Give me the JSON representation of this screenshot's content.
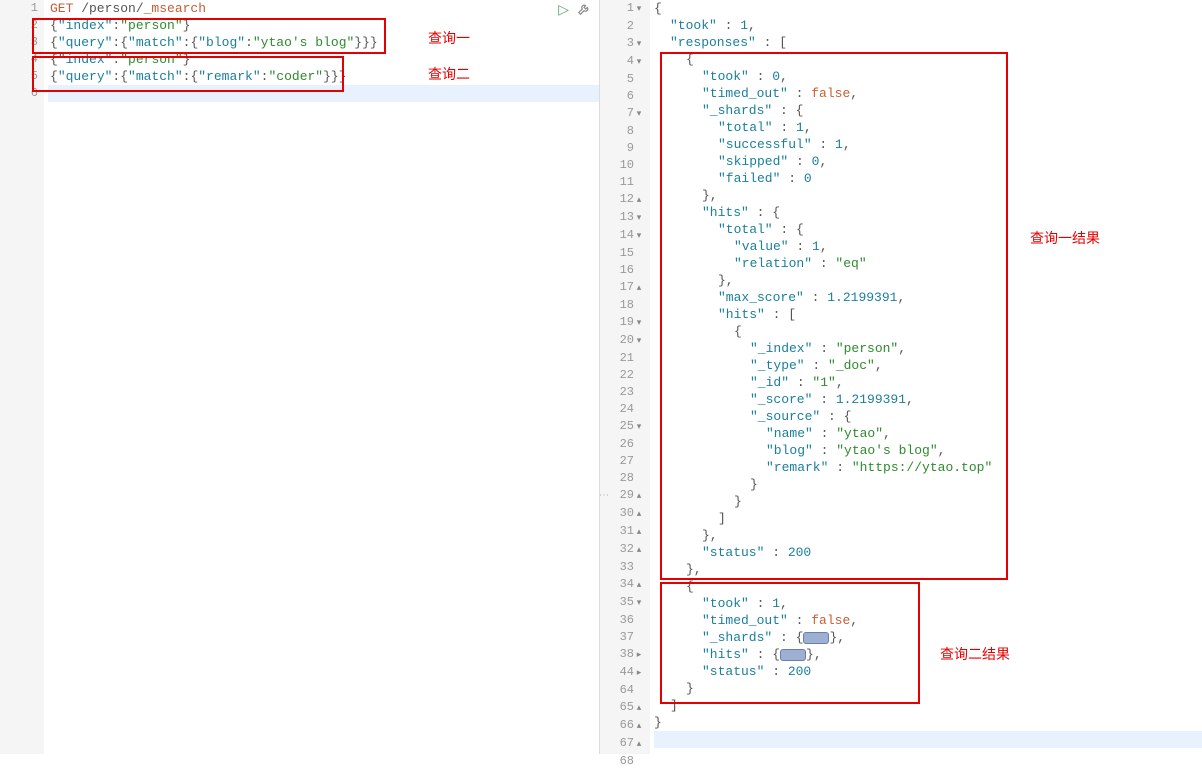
{
  "annotations": {
    "query1": "查询一",
    "query2": "查询二",
    "result1": "查询一结果",
    "result2": "查询二结果"
  },
  "left_editor": {
    "lines": [
      {
        "n": "1",
        "content": [
          {
            "t": "GET",
            "c": "kw"
          },
          {
            "t": " /person/",
            "c": "pun"
          },
          {
            "t": "_msearch",
            "c": "kw"
          }
        ]
      },
      {
        "n": "2",
        "content": [
          {
            "t": "{",
            "c": "pun"
          },
          {
            "t": "\"index\"",
            "c": "key"
          },
          {
            "t": ":",
            "c": "pun"
          },
          {
            "t": "\"person\"",
            "c": "str"
          },
          {
            "t": "}",
            "c": "pun"
          }
        ]
      },
      {
        "n": "3",
        "content": [
          {
            "t": "{",
            "c": "pun"
          },
          {
            "t": "\"query\"",
            "c": "key"
          },
          {
            "t": ":{",
            "c": "pun"
          },
          {
            "t": "\"match\"",
            "c": "key"
          },
          {
            "t": ":{",
            "c": "pun"
          },
          {
            "t": "\"blog\"",
            "c": "key"
          },
          {
            "t": ":",
            "c": "pun"
          },
          {
            "t": "\"ytao's blog\"",
            "c": "str"
          },
          {
            "t": "}}}",
            "c": "pun"
          }
        ]
      },
      {
        "n": "4",
        "content": [
          {
            "t": "{",
            "c": "pun"
          },
          {
            "t": "\"index\"",
            "c": "key"
          },
          {
            "t": ":",
            "c": "pun"
          },
          {
            "t": "\"person\"",
            "c": "str"
          },
          {
            "t": "}",
            "c": "pun"
          }
        ]
      },
      {
        "n": "5",
        "content": [
          {
            "t": "{",
            "c": "pun"
          },
          {
            "t": "\"query\"",
            "c": "key"
          },
          {
            "t": ":{",
            "c": "pun"
          },
          {
            "t": "\"match\"",
            "c": "key"
          },
          {
            "t": ":{",
            "c": "pun"
          },
          {
            "t": "\"remark\"",
            "c": "key"
          },
          {
            "t": ":",
            "c": "pun"
          },
          {
            "t": "\"coder\"",
            "c": "str"
          },
          {
            "t": "}}}",
            "c": "pun"
          }
        ]
      },
      {
        "n": "6",
        "content": [],
        "hl": true
      }
    ]
  },
  "right_editor": {
    "lines": [
      {
        "n": "1",
        "f": "▾",
        "i": 0,
        "content": [
          {
            "t": "{",
            "c": "pun"
          }
        ]
      },
      {
        "n": "2",
        "f": "",
        "i": 1,
        "content": [
          {
            "t": "\"took\"",
            "c": "key"
          },
          {
            "t": " : ",
            "c": "pun"
          },
          {
            "t": "1",
            "c": "num"
          },
          {
            "t": ",",
            "c": "pun"
          }
        ]
      },
      {
        "n": "3",
        "f": "▾",
        "i": 1,
        "content": [
          {
            "t": "\"responses\"",
            "c": "key"
          },
          {
            "t": " : [",
            "c": "pun"
          }
        ]
      },
      {
        "n": "4",
        "f": "▾",
        "i": 2,
        "content": [
          {
            "t": "{",
            "c": "pun"
          }
        ]
      },
      {
        "n": "5",
        "f": "",
        "i": 3,
        "content": [
          {
            "t": "\"took\"",
            "c": "key"
          },
          {
            "t": " : ",
            "c": "pun"
          },
          {
            "t": "0",
            "c": "num"
          },
          {
            "t": ",",
            "c": "pun"
          }
        ]
      },
      {
        "n": "6",
        "f": "",
        "i": 3,
        "content": [
          {
            "t": "\"timed_out\"",
            "c": "key"
          },
          {
            "t": " : ",
            "c": "pun"
          },
          {
            "t": "false",
            "c": "bool"
          },
          {
            "t": ",",
            "c": "pun"
          }
        ]
      },
      {
        "n": "7",
        "f": "▾",
        "i": 3,
        "content": [
          {
            "t": "\"_shards\"",
            "c": "key"
          },
          {
            "t": " : {",
            "c": "pun"
          }
        ]
      },
      {
        "n": "8",
        "f": "",
        "i": 4,
        "content": [
          {
            "t": "\"total\"",
            "c": "key"
          },
          {
            "t": " : ",
            "c": "pun"
          },
          {
            "t": "1",
            "c": "num"
          },
          {
            "t": ",",
            "c": "pun"
          }
        ]
      },
      {
        "n": "9",
        "f": "",
        "i": 4,
        "content": [
          {
            "t": "\"successful\"",
            "c": "key"
          },
          {
            "t": " : ",
            "c": "pun"
          },
          {
            "t": "1",
            "c": "num"
          },
          {
            "t": ",",
            "c": "pun"
          }
        ]
      },
      {
        "n": "10",
        "f": "",
        "i": 4,
        "content": [
          {
            "t": "\"skipped\"",
            "c": "key"
          },
          {
            "t": " : ",
            "c": "pun"
          },
          {
            "t": "0",
            "c": "num"
          },
          {
            "t": ",",
            "c": "pun"
          }
        ]
      },
      {
        "n": "11",
        "f": "",
        "i": 4,
        "content": [
          {
            "t": "\"failed\"",
            "c": "key"
          },
          {
            "t": " : ",
            "c": "pun"
          },
          {
            "t": "0",
            "c": "num"
          }
        ]
      },
      {
        "n": "12",
        "f": "▴",
        "i": 3,
        "content": [
          {
            "t": "},",
            "c": "pun"
          }
        ]
      },
      {
        "n": "13",
        "f": "▾",
        "i": 3,
        "content": [
          {
            "t": "\"hits\"",
            "c": "key"
          },
          {
            "t": " : {",
            "c": "pun"
          }
        ]
      },
      {
        "n": "14",
        "f": "▾",
        "i": 4,
        "content": [
          {
            "t": "\"total\"",
            "c": "key"
          },
          {
            "t": " : {",
            "c": "pun"
          }
        ]
      },
      {
        "n": "15",
        "f": "",
        "i": 5,
        "content": [
          {
            "t": "\"value\"",
            "c": "key"
          },
          {
            "t": " : ",
            "c": "pun"
          },
          {
            "t": "1",
            "c": "num"
          },
          {
            "t": ",",
            "c": "pun"
          }
        ]
      },
      {
        "n": "16",
        "f": "",
        "i": 5,
        "content": [
          {
            "t": "\"relation\"",
            "c": "key"
          },
          {
            "t": " : ",
            "c": "pun"
          },
          {
            "t": "\"eq\"",
            "c": "str"
          }
        ]
      },
      {
        "n": "17",
        "f": "▴",
        "i": 4,
        "content": [
          {
            "t": "},",
            "c": "pun"
          }
        ]
      },
      {
        "n": "18",
        "f": "",
        "i": 4,
        "content": [
          {
            "t": "\"max_score\"",
            "c": "key"
          },
          {
            "t": " : ",
            "c": "pun"
          },
          {
            "t": "1.2199391",
            "c": "num"
          },
          {
            "t": ",",
            "c": "pun"
          }
        ]
      },
      {
        "n": "19",
        "f": "▾",
        "i": 4,
        "content": [
          {
            "t": "\"hits\"",
            "c": "key"
          },
          {
            "t": " : [",
            "c": "pun"
          }
        ]
      },
      {
        "n": "20",
        "f": "▾",
        "i": 5,
        "content": [
          {
            "t": "{",
            "c": "pun"
          }
        ]
      },
      {
        "n": "21",
        "f": "",
        "i": 6,
        "content": [
          {
            "t": "\"_index\"",
            "c": "key"
          },
          {
            "t": " : ",
            "c": "pun"
          },
          {
            "t": "\"person\"",
            "c": "str"
          },
          {
            "t": ",",
            "c": "pun"
          }
        ]
      },
      {
        "n": "22",
        "f": "",
        "i": 6,
        "content": [
          {
            "t": "\"_type\"",
            "c": "key"
          },
          {
            "t": " : ",
            "c": "pun"
          },
          {
            "t": "\"_doc\"",
            "c": "str"
          },
          {
            "t": ",",
            "c": "pun"
          }
        ]
      },
      {
        "n": "23",
        "f": "",
        "i": 6,
        "content": [
          {
            "t": "\"_id\"",
            "c": "key"
          },
          {
            "t": " : ",
            "c": "pun"
          },
          {
            "t": "\"1\"",
            "c": "str"
          },
          {
            "t": ",",
            "c": "pun"
          }
        ]
      },
      {
        "n": "24",
        "f": "",
        "i": 6,
        "content": [
          {
            "t": "\"_score\"",
            "c": "key"
          },
          {
            "t": " : ",
            "c": "pun"
          },
          {
            "t": "1.2199391",
            "c": "num"
          },
          {
            "t": ",",
            "c": "pun"
          }
        ]
      },
      {
        "n": "25",
        "f": "▾",
        "i": 6,
        "content": [
          {
            "t": "\"_source\"",
            "c": "key"
          },
          {
            "t": " : {",
            "c": "pun"
          }
        ]
      },
      {
        "n": "26",
        "f": "",
        "i": 7,
        "content": [
          {
            "t": "\"name\"",
            "c": "key"
          },
          {
            "t": " : ",
            "c": "pun"
          },
          {
            "t": "\"ytao\"",
            "c": "str"
          },
          {
            "t": ",",
            "c": "pun"
          }
        ]
      },
      {
        "n": "27",
        "f": "",
        "i": 7,
        "content": [
          {
            "t": "\"blog\"",
            "c": "key"
          },
          {
            "t": " : ",
            "c": "pun"
          },
          {
            "t": "\"ytao's blog\"",
            "c": "str"
          },
          {
            "t": ",",
            "c": "pun"
          }
        ]
      },
      {
        "n": "28",
        "f": "",
        "i": 7,
        "content": [
          {
            "t": "\"remark\"",
            "c": "key"
          },
          {
            "t": " : ",
            "c": "pun"
          },
          {
            "t": "\"https://ytao.top\"",
            "c": "str"
          }
        ]
      },
      {
        "n": "29",
        "f": "▴",
        "i": 6,
        "content": [
          {
            "t": "}",
            "c": "pun"
          }
        ]
      },
      {
        "n": "30",
        "f": "▴",
        "i": 5,
        "content": [
          {
            "t": "}",
            "c": "pun"
          }
        ]
      },
      {
        "n": "31",
        "f": "▴",
        "i": 4,
        "content": [
          {
            "t": "]",
            "c": "pun"
          }
        ]
      },
      {
        "n": "32",
        "f": "▴",
        "i": 3,
        "content": [
          {
            "t": "},",
            "c": "pun"
          }
        ]
      },
      {
        "n": "33",
        "f": "",
        "i": 3,
        "content": [
          {
            "t": "\"status\"",
            "c": "key"
          },
          {
            "t": " : ",
            "c": "pun"
          },
          {
            "t": "200",
            "c": "num"
          }
        ]
      },
      {
        "n": "34",
        "f": "▴",
        "i": 2,
        "content": [
          {
            "t": "},",
            "c": "pun"
          }
        ]
      },
      {
        "n": "35",
        "f": "▾",
        "i": 2,
        "content": [
          {
            "t": "{",
            "c": "pun"
          }
        ]
      },
      {
        "n": "36",
        "f": "",
        "i": 3,
        "content": [
          {
            "t": "\"took\"",
            "c": "key"
          },
          {
            "t": " : ",
            "c": "pun"
          },
          {
            "t": "1",
            "c": "num"
          },
          {
            "t": ",",
            "c": "pun"
          }
        ]
      },
      {
        "n": "37",
        "f": "",
        "i": 3,
        "content": [
          {
            "t": "\"timed_out\"",
            "c": "key"
          },
          {
            "t": " : ",
            "c": "pun"
          },
          {
            "t": "false",
            "c": "bool"
          },
          {
            "t": ",",
            "c": "pun"
          }
        ]
      },
      {
        "n": "38",
        "f": "▸",
        "i": 3,
        "content": [
          {
            "t": "\"_shards\"",
            "c": "key"
          },
          {
            "t": " : {",
            "c": "pun"
          },
          {
            "t": "BADGE",
            "c": "badge"
          },
          {
            "t": "},",
            "c": "pun"
          }
        ]
      },
      {
        "n": "44",
        "f": "▸",
        "i": 3,
        "content": [
          {
            "t": "\"hits\"",
            "c": "key"
          },
          {
            "t": " : {",
            "c": "pun"
          },
          {
            "t": "BADGE",
            "c": "badge"
          },
          {
            "t": "},",
            "c": "pun"
          }
        ]
      },
      {
        "n": "64",
        "f": "",
        "i": 3,
        "content": [
          {
            "t": "\"status\"",
            "c": "key"
          },
          {
            "t": " : ",
            "c": "pun"
          },
          {
            "t": "200",
            "c": "num"
          }
        ]
      },
      {
        "n": "65",
        "f": "▴",
        "i": 2,
        "content": [
          {
            "t": "}",
            "c": "pun"
          }
        ]
      },
      {
        "n": "66",
        "f": "▴",
        "i": 1,
        "content": [
          {
            "t": "]",
            "c": "pun"
          }
        ]
      },
      {
        "n": "67",
        "f": "▴",
        "i": 0,
        "content": [
          {
            "t": "}",
            "c": "pun"
          }
        ]
      },
      {
        "n": "68",
        "f": "",
        "i": 0,
        "content": [],
        "hl": true
      }
    ]
  }
}
